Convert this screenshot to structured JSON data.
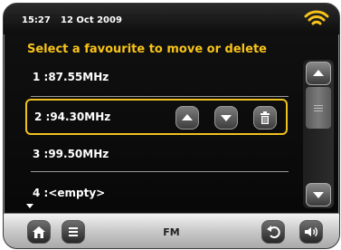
{
  "status": {
    "time": "15:27",
    "date": "12 Oct  2009"
  },
  "heading": "Select a favourite to move or delete",
  "favourites": [
    {
      "label": "1 :87.55MHz",
      "selected": false
    },
    {
      "label": "2 :94.30MHz",
      "selected": true
    },
    {
      "label": "3 :99.50MHz",
      "selected": false
    },
    {
      "label": "4 :<empty>",
      "selected": false
    }
  ],
  "bottom": {
    "mode": "FM"
  },
  "colors": {
    "accent": "#f7c31a",
    "selection": "#f0c020"
  },
  "icons": [
    "wifi-icon",
    "move-up-icon",
    "move-down-icon",
    "trash-icon",
    "scroll-up-icon",
    "scroll-down-icon",
    "home-icon",
    "menu-icon",
    "back-icon",
    "volume-icon"
  ]
}
